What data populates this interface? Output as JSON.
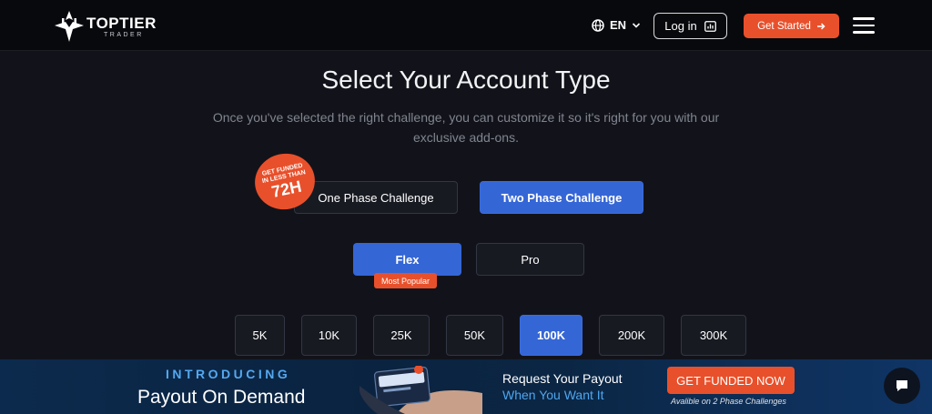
{
  "header": {
    "logo_main": "TOPTIER",
    "logo_sub": "TRADER",
    "language": "EN",
    "login_label": "Log in",
    "get_started_label": "Get Started"
  },
  "main": {
    "title": "Select Your Account Type",
    "subtitle": "Once you've selected the right challenge, you can customize it so it's right for you with our exclusive add-ons.",
    "badge": {
      "small_text": "GET FUNDED IN LESS THAN",
      "big_text": "72H"
    },
    "phases": [
      {
        "label": "One Phase Challenge",
        "selected": false
      },
      {
        "label": "Two Phase Challenge",
        "selected": true
      }
    ],
    "types": [
      {
        "label": "Flex",
        "selected": true
      },
      {
        "label": "Pro",
        "selected": false
      }
    ],
    "popular_label": "Most Popular",
    "sizes": [
      {
        "label": "5K",
        "selected": false
      },
      {
        "label": "10K",
        "selected": false
      },
      {
        "label": "25K",
        "selected": false
      },
      {
        "label": "50K",
        "selected": false
      },
      {
        "label": "100K",
        "selected": true
      },
      {
        "label": "200K",
        "selected": false
      },
      {
        "label": "300K",
        "selected": false
      }
    ]
  },
  "banner": {
    "intro": "INTRODUCING",
    "title": "Payout On Demand",
    "request_line1": "Request Your Payout",
    "request_line2": "When You Want It",
    "cta_label": "GET FUNDED NOW",
    "availability": "Avalible on 2 Phase Challenges"
  },
  "colors": {
    "accent_orange": "#e8502b",
    "accent_blue": "#3566d6",
    "background": "#12131a",
    "banner_blue": "#0a2340"
  }
}
